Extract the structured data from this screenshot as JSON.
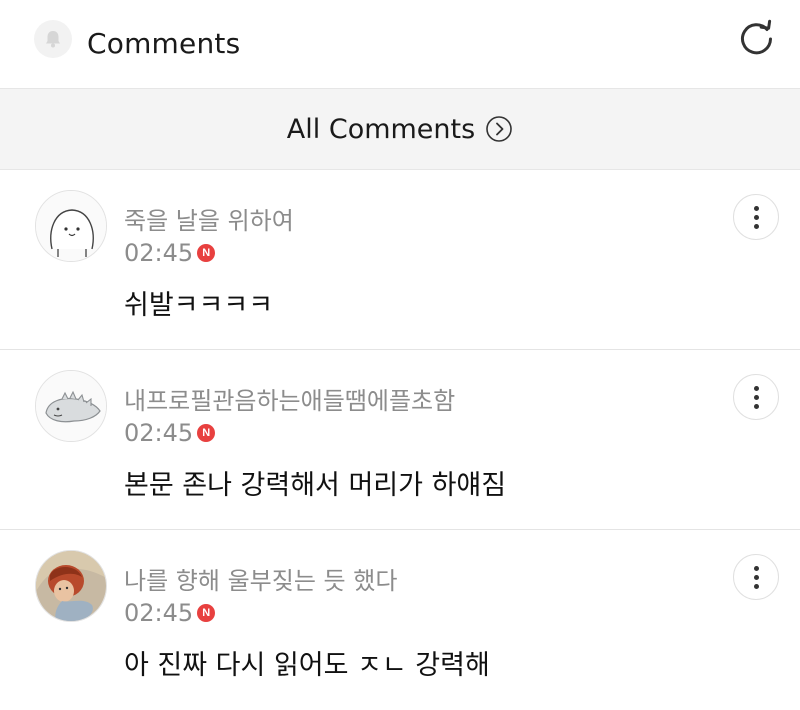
{
  "header": {
    "title": "Comments",
    "bell_icon": "bell-icon",
    "refresh_icon": "refresh-icon"
  },
  "filter": {
    "label": "All Comments",
    "icon": "chevron-right-circle-icon"
  },
  "badge_letter": "N",
  "colors": {
    "badge_red": "#e8403f",
    "meta_gray": "#8c8c8c",
    "bar_bg": "#f4f4f4"
  },
  "comments": [
    {
      "author": "죽을 날을 위하여",
      "time": "02:45",
      "text": "쉬발ㅋㅋㅋㅋ",
      "avatar_icon": "blob-face-avatar-icon"
    },
    {
      "author": "내프로필관음하는애들땜에플초함",
      "time": "02:45",
      "text": "본문 존나 강력해서 머리가 하얘짐",
      "avatar_icon": "dinosaur-avatar-icon"
    },
    {
      "author": "나를 향해 울부짖는 듯 했다",
      "time": "02:45",
      "text": "아 진짜 다시 읽어도 ㅈㄴ 강력해",
      "avatar_icon": "photo-avatar-icon"
    }
  ]
}
